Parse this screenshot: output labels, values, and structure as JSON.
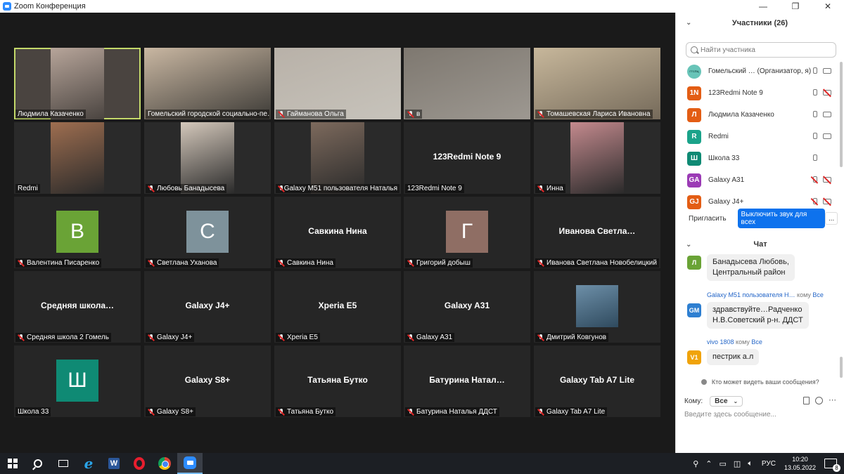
{
  "window": {
    "title": "Zoom Конференция",
    "controls": [
      "—",
      "❐",
      "✕"
    ]
  },
  "tiles": [
    {
      "label": "Людмила Казаченко",
      "muted": false,
      "active": true,
      "kind": "video",
      "bg": "#4a4440",
      "img": "#b7a59a"
    },
    {
      "label": "Гомельский городской социально-пе…",
      "muted": false,
      "kind": "video",
      "bg": "#3c3a36",
      "img": "#c9b7a2"
    },
    {
      "label": "Гайманова Ольга",
      "muted": true,
      "kind": "video",
      "bg": "#c7c3bb",
      "img": "#b8b1a8"
    },
    {
      "label": "в",
      "muted": true,
      "kind": "video",
      "bg": "#9d9891",
      "img": "#7e7870"
    },
    {
      "label": "Томашевская Лариса Ивановна",
      "muted": true,
      "kind": "video",
      "bg": "#756a5a",
      "img": "#c7b79b"
    },
    {
      "label": "Redmi",
      "muted": false,
      "kind": "video",
      "bg": "#2a2a2a",
      "img": "#9e6e50"
    },
    {
      "label": "Любовь Банадысева",
      "muted": true,
      "kind": "video",
      "bg": "#2a2a2a",
      "img": "#d4c8bb"
    },
    {
      "label": "Galaxy M51 пользователя Наталья",
      "muted": true,
      "kind": "video",
      "bg": "#2a2a2a",
      "img": "#7d6a5d"
    },
    {
      "label": "123Redmi Note 9",
      "muted": false,
      "kind": "name",
      "center": "123Redmi Note 9"
    },
    {
      "label": "Инна",
      "muted": true,
      "kind": "video",
      "bg": "#2a2a2a",
      "img": "#c48a8e"
    },
    {
      "label": "Валентина Писаренко",
      "muted": true,
      "kind": "letter",
      "letter": "В",
      "color": "#6aa336"
    },
    {
      "label": "Светлана Уханова",
      "muted": true,
      "kind": "letter",
      "letter": "С",
      "color": "#7e929b"
    },
    {
      "label": "Савкина Нина",
      "muted": true,
      "kind": "name",
      "center": "Савкина Нина"
    },
    {
      "label": "Григорий добыш",
      "muted": true,
      "kind": "letter",
      "letter": "Г",
      "color": "#8f6e64"
    },
    {
      "label": "Иванова Светлана Новобелицкий",
      "muted": true,
      "kind": "name",
      "center": "Иванова  Светла…"
    },
    {
      "label": "Средняя школа 2 Гомель",
      "muted": true,
      "kind": "name",
      "center": "Средняя  школа…"
    },
    {
      "label": "Galaxy J4+",
      "muted": true,
      "kind": "name",
      "center": "Galaxy J4+"
    },
    {
      "label": "Xperia E5",
      "muted": true,
      "kind": "name",
      "center": "Xperia E5"
    },
    {
      "label": "Galaxy A31",
      "muted": true,
      "kind": "name",
      "center": "Galaxy A31"
    },
    {
      "label": "Дмитрий Ковгунов",
      "muted": true,
      "kind": "photo",
      "img": "#6d8fa8"
    },
    {
      "label": "Школа 33",
      "muted": false,
      "kind": "letter",
      "letter": "Ш",
      "color": "#0f8a74"
    },
    {
      "label": "Galaxy S8+",
      "muted": true,
      "kind": "name",
      "center": "Galaxy S8+"
    },
    {
      "label": "Татьяна Бутко",
      "muted": true,
      "kind": "name",
      "center": "Татьяна Бутко"
    },
    {
      "label": "Батурина Наталья ДДСТ",
      "muted": true,
      "kind": "name",
      "center": "Батурина  Натал…"
    },
    {
      "label": "Galaxy Tab A7 Lite",
      "muted": true,
      "kind": "name",
      "center": "Galaxy Tab A7 Lite"
    }
  ],
  "participants_panel": {
    "title": "Участники (26)",
    "search_placeholder": "Найти участника",
    "items": [
      {
        "avatar": "ГГСПЦ",
        "color": "#68c4b8",
        "name": "Гомельский …  (Организатор, я)",
        "mic_muted": false,
        "cam_muted": false
      },
      {
        "avatar": "1N",
        "color": "#e35d14",
        "name": "123Redmi Note 9",
        "mic_muted": false,
        "cam_muted": true
      },
      {
        "avatar": "Л",
        "color": "#e35d14",
        "name": "Людмила Казаченко",
        "mic_muted": false,
        "cam_muted": false
      },
      {
        "avatar": "R",
        "color": "#1aa38a",
        "name": "Redmi",
        "mic_muted": false,
        "cam_muted": false
      },
      {
        "avatar": "Ш",
        "color": "#0f8a74",
        "name": "Школа 33",
        "mic_muted": false,
        "cam_muted": null
      },
      {
        "avatar": "GA",
        "color": "#9b3bb5",
        "name": "Galaxy A31",
        "mic_muted": true,
        "cam_muted": true
      },
      {
        "avatar": "GJ",
        "color": "#e35d14",
        "name": "Galaxy J4+",
        "mic_muted": true,
        "cam_muted": true
      }
    ],
    "invite_label": "Пригласить",
    "mute_all_label": "Выключить звук для всех",
    "more_label": "..."
  },
  "chat": {
    "title": "Чат",
    "messages": [
      {
        "avatar": "Л",
        "color": "#6aa336",
        "from": "",
        "to_label": "",
        "to": "",
        "lines": [
          "Банадысева Любовь,",
          "Центральный район"
        ]
      },
      {
        "avatar": "GM",
        "color": "#2e7fd1",
        "from": "Galaxy M51 пользователя Н…",
        "to_label": "кому",
        "to": "Все",
        "lines": [
          "здравствуйте…Радченко",
          "Н.В.Советский р-н. ДДСТ"
        ]
      },
      {
        "avatar": "V1",
        "color": "#f0a30a",
        "from": "vivo 1808",
        "to_label": "кому",
        "to": "Все",
        "lines": [
          "пестрик а.л"
        ]
      }
    ],
    "who_sees": "Кто может видеть ваши сообщения?",
    "to_label": "Кому:",
    "to_value": "Все",
    "input_placeholder": "Введите здесь сообщение..."
  },
  "taskbar": {
    "lang": "РУС",
    "time": "10:20",
    "date": "13.05.2022",
    "notifications": "8",
    "word_letter": "W",
    "ie_letter": "e"
  }
}
